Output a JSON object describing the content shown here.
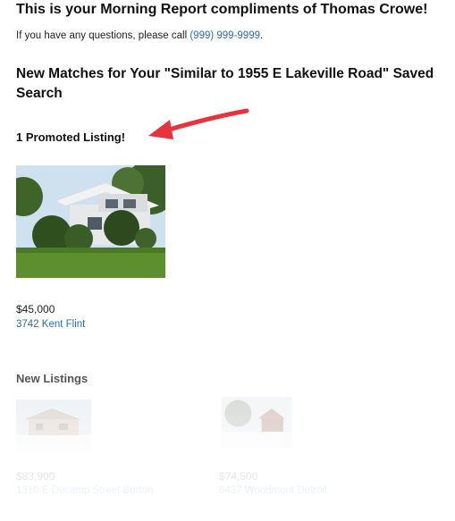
{
  "header": {
    "title": "This is your Morning Report compliments of Thomas Crowe!",
    "intro_prefix": "If you have any questions, please call ",
    "phone": "(999) 999-9999",
    "intro_suffix": "."
  },
  "matches": {
    "heading": "New Matches for Your \"Similar to 1955 E Lakeville Road\" Saved Search"
  },
  "promoted": {
    "heading": "1 Promoted Listing!",
    "listing": {
      "price": "$45,000",
      "address": "3742 Kent Flint"
    }
  },
  "new_listings": {
    "heading": "New Listings",
    "items": [
      {
        "price": "$83,900",
        "address": "1310 E Decamp Street Burton"
      },
      {
        "price": "$74,500",
        "address": "6437 Woodmont Detroit"
      }
    ]
  },
  "colors": {
    "link": "#2b6cb0",
    "arrow": "#e8323c"
  }
}
